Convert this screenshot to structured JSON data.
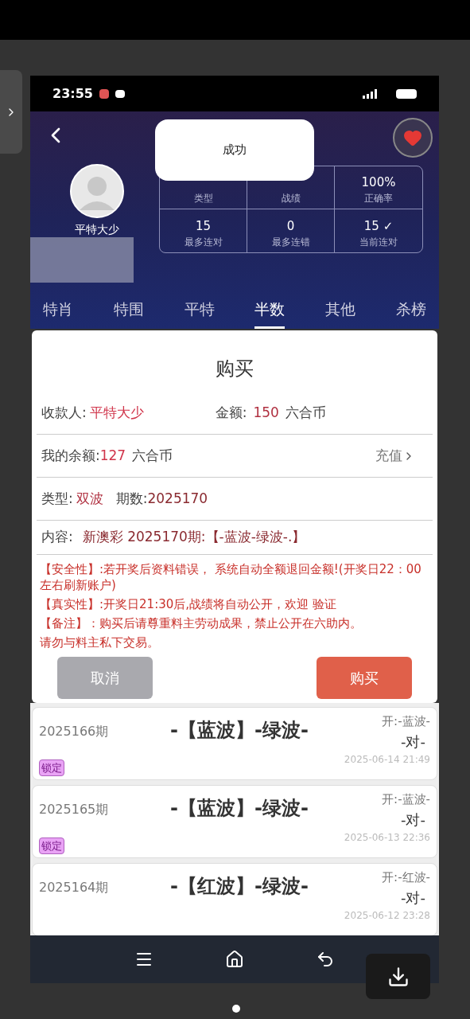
{
  "status_bar": {
    "time": "23:55"
  },
  "header": {
    "toast": "成功",
    "user_name": "平特大少",
    "favorited": true,
    "stats": [
      {
        "label": "类型"
      },
      {
        "label": "战绩"
      },
      {
        "value": "100%",
        "label": "正确率"
      },
      {
        "value": "15",
        "label": "最多连对"
      },
      {
        "value": "0",
        "label": "最多连错"
      },
      {
        "value": "15 ✓",
        "label": "当前连对"
      }
    ]
  },
  "tabs": [
    {
      "label": "特肖",
      "selected": false
    },
    {
      "label": "特围",
      "selected": false
    },
    {
      "label": "平特",
      "selected": false
    },
    {
      "label": "半数",
      "selected": true
    },
    {
      "label": "其他",
      "selected": false
    },
    {
      "label": "杀榜",
      "selected": false
    }
  ],
  "dialog": {
    "title": "购买",
    "payee_label": "收款人:",
    "payee": "平特大少",
    "amount_label": "金额:",
    "amount": "150",
    "amount_unit": "六合币",
    "balance_label": "我的余额:",
    "balance": "127",
    "balance_unit": "六合币",
    "recharge": "充值",
    "type_label": "类型:",
    "type": "双波",
    "period_label": "期数:",
    "period": "2025170",
    "content_label": "内容:",
    "content": "新澳彩 2025170期:【-蓝波-绿波-.】",
    "notices": [
      "【安全性】:若开奖后资料错误， 系统自动全额退回金额!(开奖日22：00左右刷新账户)",
      "【真实性】:开奖日21:30后,战绩将自动公开，欢迎 验证",
      "【备注】：购买后请尊重料主劳动成果，禁止公开在六助内。",
      "请勿与料主私下交易。"
    ],
    "cancel": "取消",
    "confirm": "购买"
  },
  "records": [
    {
      "period": "2025166期",
      "pick": "-【蓝波】-绿波-",
      "draw": "开:-蓝波-",
      "result": "-对-",
      "time": "2025-06-14 21:49",
      "tag": "锁定"
    },
    {
      "period": "2025165期",
      "pick": "-【蓝波】-绿波-",
      "draw": "开:-蓝波-",
      "result": "-对-",
      "time": "2025-06-13 22:36",
      "tag": "锁定"
    },
    {
      "period": "2025164期",
      "pick": "-【红波】-绿波-",
      "draw": "开:-红波-",
      "result": "-对-",
      "time": "2025-06-12 23:28"
    }
  ]
}
